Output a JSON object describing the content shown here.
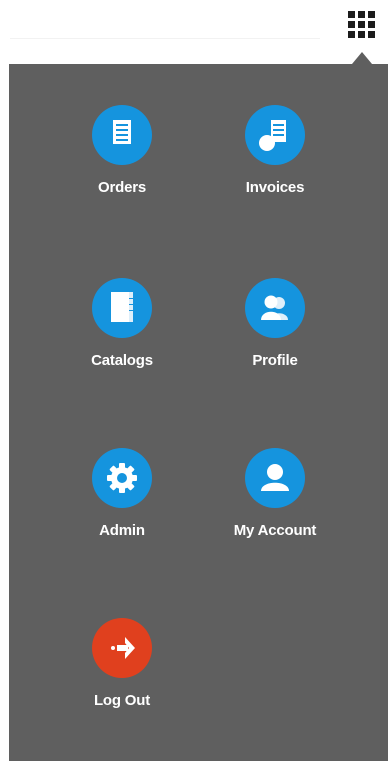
{
  "header": {
    "launcher_icon": "grid-icon"
  },
  "menu": {
    "items": [
      {
        "label": "Orders",
        "icon": "document-icon",
        "color": "#1594de"
      },
      {
        "label": "Invoices",
        "icon": "invoice-icon",
        "color": "#1594de"
      },
      {
        "label": "Catalogs",
        "icon": "book-icon",
        "color": "#1594de"
      },
      {
        "label": "Profile",
        "icon": "users-icon",
        "color": "#1594de"
      },
      {
        "label": "Admin",
        "icon": "gear-icon",
        "color": "#1594de"
      },
      {
        "label": "My Account",
        "icon": "user-icon",
        "color": "#1594de"
      },
      {
        "label": "Log Out",
        "icon": "arrow-right-icon",
        "color": "#e0401e"
      }
    ]
  },
  "colors": {
    "panel": "#5f5f5f",
    "accent": "#1594de",
    "logout": "#e0401e"
  }
}
